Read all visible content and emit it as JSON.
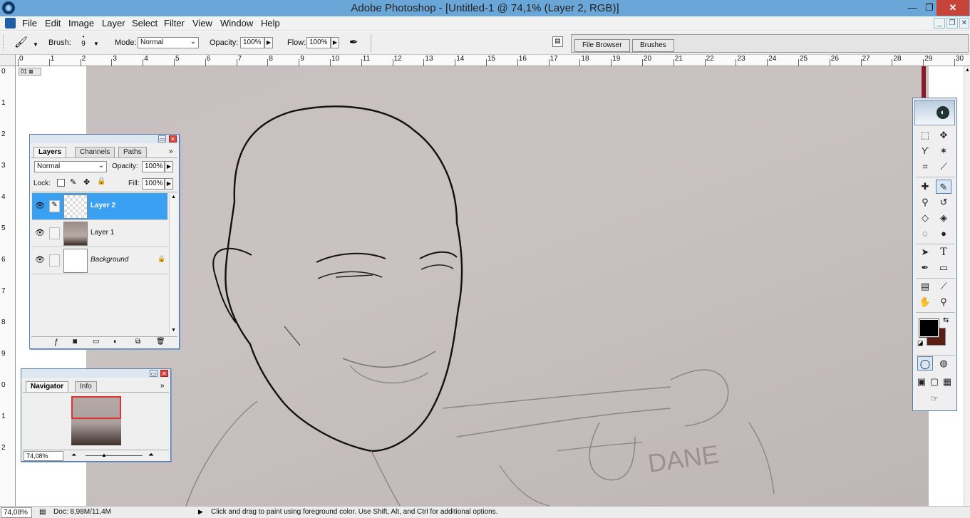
{
  "window": {
    "title": "Adobe Photoshop - [Untitled-1 @ 74,1% (Layer 2, RGB)]",
    "app_icon": "photoshop-eye-icon",
    "controls": [
      "minimize",
      "restore",
      "close"
    ]
  },
  "menu": {
    "items": [
      "File",
      "Edit",
      "Image",
      "Layer",
      "Select",
      "Filter",
      "View",
      "Window",
      "Help"
    ]
  },
  "options": {
    "brush_label": "Brush:",
    "brush_size": "9",
    "mode_label": "Mode:",
    "mode_value": "Normal",
    "opacity_label": "Opacity:",
    "opacity_value": "100%",
    "flow_label": "Flow:",
    "flow_value": "100%",
    "well_tabs": [
      "File Browser",
      "Brushes"
    ]
  },
  "rulers": {
    "h_labels": [
      "0",
      "1",
      "2",
      "3",
      "4",
      "5",
      "6",
      "7",
      "8",
      "9",
      "10",
      "11",
      "12",
      "13",
      "14",
      "15",
      "16",
      "17",
      "18",
      "19",
      "20",
      "21",
      "22",
      "23",
      "24",
      "25",
      "26",
      "27",
      "28",
      "29",
      "30"
    ],
    "v_labels": [
      "0",
      "1",
      "2",
      "3",
      "4",
      "5",
      "6",
      "7",
      "8",
      "9",
      "0",
      "1",
      "2"
    ]
  },
  "canvas": {
    "tab_label": "01",
    "annotation_text": "DANE"
  },
  "layers_palette": {
    "tabs": [
      "Layers",
      "Channels",
      "Paths"
    ],
    "blend_mode": "Normal",
    "opacity_label": "Opacity:",
    "opacity_value": "100%",
    "lock_label": "Lock:",
    "fill_label": "Fill:",
    "fill_value": "100%",
    "layers": [
      {
        "name": "Layer 2",
        "selected": true
      },
      {
        "name": "Layer 1",
        "selected": false
      },
      {
        "name": "Background",
        "selected": false
      }
    ]
  },
  "navigator_palette": {
    "tabs": [
      "Navigator",
      "Info"
    ],
    "zoom_value": "74,08%"
  },
  "status": {
    "zoom": "74,08%",
    "doc_info": "Doc: 8,98M/11,4M",
    "hint": "Click and drag to paint using foreground color.  Use Shift, Alt, and Ctrl for additional options."
  },
  "colors": {
    "foreground": "#000000",
    "background": "#5a1e14",
    "accent": "#3aa0f2"
  }
}
